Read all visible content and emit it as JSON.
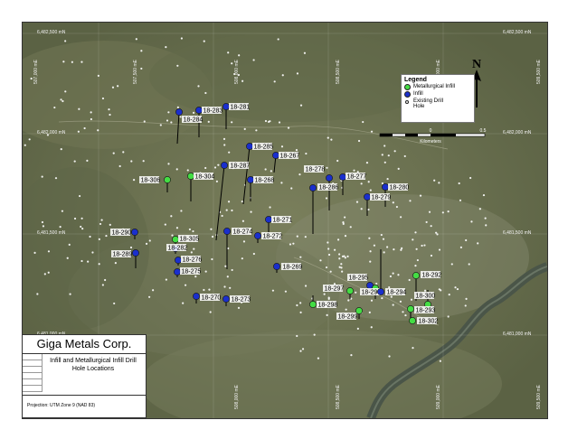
{
  "legend": {
    "title": "Legend",
    "items": [
      {
        "label": "Metallurgical Infill",
        "color": "#44dd44"
      },
      {
        "label": "Infill",
        "color": "#1a2fcc"
      },
      {
        "label": "Existing Drill Hole",
        "color": "#ffffff"
      }
    ]
  },
  "north_arrow": {
    "label": "N"
  },
  "scale_bar": {
    "unit": "Kilometers",
    "ticks": [
      "0",
      "0.5"
    ]
  },
  "title_block": {
    "company": "Giga Metals Corp.",
    "subtitle": "Infill and Metallurgical Infill Drill Hole Locations",
    "projection": "Projection: UTM Zone 9 (NAD 83)"
  },
  "grid_labels": {
    "northing": [
      "6,482,500 mN",
      "6,482,000 mN",
      "6,481,500 mN",
      "6,481,000 mN"
    ],
    "easting": [
      "507,000 mE",
      "507,500 mE",
      "508,000 mE",
      "508,500 mE",
      "509,000 mE",
      "509,500 mE"
    ]
  },
  "drill_holes": [
    {
      "id": "18-281",
      "type": "infill"
    },
    {
      "id": "18-283",
      "type": "infill"
    },
    {
      "id": "18-284",
      "type": "infill"
    },
    {
      "id": "18-285",
      "type": "infill"
    },
    {
      "id": "18-267",
      "type": "infill"
    },
    {
      "id": "18-287",
      "type": "infill"
    },
    {
      "id": "18-304",
      "type": "metallurgical"
    },
    {
      "id": "18-306",
      "type": "metallurgical"
    },
    {
      "id": "18-268",
      "type": "infill"
    },
    {
      "id": "18-278",
      "type": "infill"
    },
    {
      "id": "18-277",
      "type": "infill"
    },
    {
      "id": "18-286",
      "type": "infill"
    },
    {
      "id": "18-280",
      "type": "infill"
    },
    {
      "id": "18-279",
      "type": "infill"
    },
    {
      "id": "18-271",
      "type": "infill"
    },
    {
      "id": "18-290",
      "type": "infill"
    },
    {
      "id": "18-305",
      "type": "metallurgical"
    },
    {
      "id": "18-274",
      "type": "infill"
    },
    {
      "id": "18-272",
      "type": "infill"
    },
    {
      "id": "18-282",
      "type": "infill"
    },
    {
      "id": "18-289",
      "type": "infill"
    },
    {
      "id": "18-276",
      "type": "infill"
    },
    {
      "id": "18-275",
      "type": "infill"
    },
    {
      "id": "18-269",
      "type": "infill"
    },
    {
      "id": "18-295",
      "type": "infill"
    },
    {
      "id": "18-292",
      "type": "metallurgical"
    },
    {
      "id": "18-297",
      "type": "metallurgical"
    },
    {
      "id": "18-296",
      "type": "metallurgical"
    },
    {
      "id": "18-294",
      "type": "infill"
    },
    {
      "id": "18-270",
      "type": "infill"
    },
    {
      "id": "18-273",
      "type": "infill"
    },
    {
      "id": "18-298",
      "type": "metallurgical"
    },
    {
      "id": "18-300",
      "type": "metallurgical"
    },
    {
      "id": "18-293",
      "type": "metallurgical"
    },
    {
      "id": "18-299",
      "type": "metallurgical"
    },
    {
      "id": "18-302",
      "type": "metallurgical"
    }
  ],
  "colors": {
    "infill": "#1a2fcc",
    "metallurgical": "#44dd44",
    "existing": "#ffffff",
    "terrain": "#6b7350",
    "river": "#4f5a4a"
  }
}
